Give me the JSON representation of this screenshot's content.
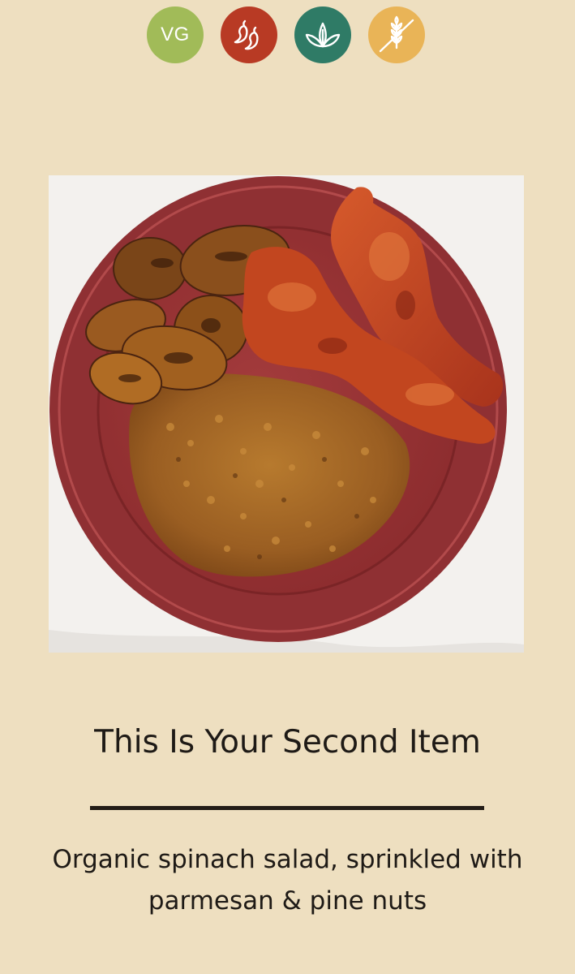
{
  "dietary_badges": [
    {
      "name": "vegetarian",
      "label": "VG",
      "color": "#a1bb58"
    },
    {
      "name": "spicy",
      "icon": "chili-peppers-icon",
      "color": "#b83a24"
    },
    {
      "name": "vegan",
      "icon": "leaves-icon",
      "color": "#2f7b66"
    },
    {
      "name": "gluten-free",
      "icon": "crossed-wheat-icon",
      "color": "#e9b457"
    }
  ],
  "item": {
    "title": "This Is Your Second Item",
    "description": "Organic spinach salad, sprinkled with parmesan & pine nuts"
  }
}
